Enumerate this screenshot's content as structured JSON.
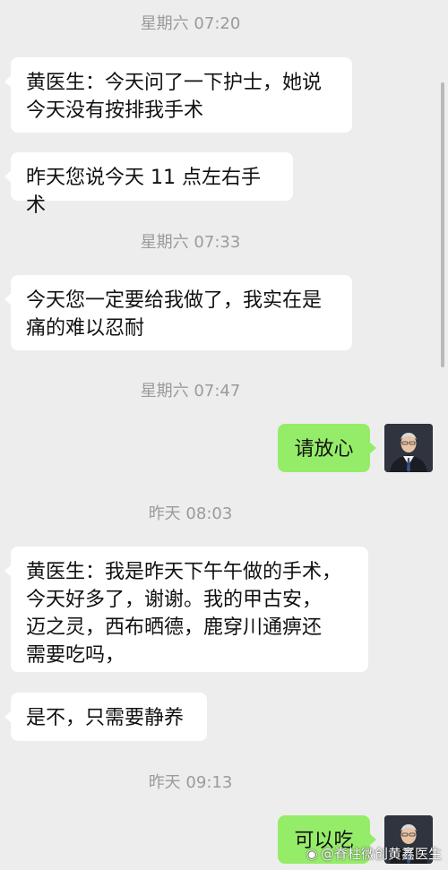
{
  "chat": {
    "timestamps": [
      "星期六 07:20",
      "星期六 07:33",
      "星期六 07:47",
      "昨天 08:03",
      "昨天 09:13"
    ],
    "messages": [
      {
        "side": "left",
        "text": "黄医生：今天问了一下护士，她说\n今天没有按排我手术"
      },
      {
        "side": "left",
        "text": "昨天您说今天 11 点左右手术"
      },
      {
        "side": "left",
        "text": "今天您一定要给我做了，我实在是\n痛的难以忍耐"
      },
      {
        "side": "right",
        "text": "请放心"
      },
      {
        "side": "left",
        "text": "黄医生：我是昨天下午午做的手术，\n今天好多了，谢谢。我的甲古安，\n迈之灵，西布晒德，鹿穿川通痹还\n需要吃吗，"
      },
      {
        "side": "left",
        "text": "是不，只需要静养"
      },
      {
        "side": "right",
        "text": "可以吃"
      }
    ]
  },
  "watermark": {
    "logo_icon": "weibo-icon",
    "text": "@脊柱微创黄鑫医生"
  },
  "colors": {
    "background": "#ededed",
    "bubble_left": "#ffffff",
    "bubble_right": "#95ec69",
    "timestamp": "#9b9b9b"
  }
}
